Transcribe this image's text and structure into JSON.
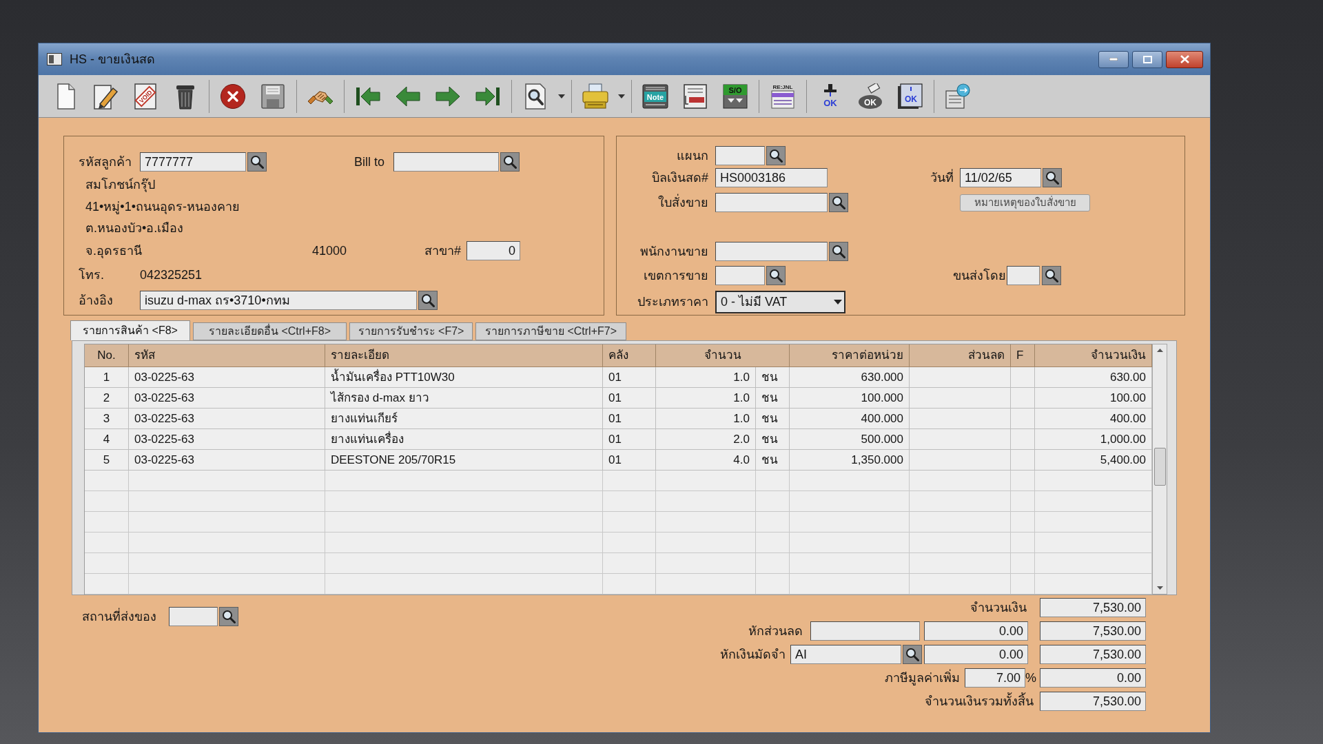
{
  "window": {
    "title": "HS - ขายเงินสด"
  },
  "toolbar": {
    "groups": [
      [
        {
          "kind": "new",
          "dropdown": false
        },
        {
          "kind": "edit",
          "dropdown": false
        },
        {
          "kind": "void",
          "text": "VOID",
          "dropdown": false
        },
        {
          "kind": "delete",
          "dropdown": false
        }
      ],
      [
        {
          "kind": "cancel",
          "dropdown": false
        },
        {
          "kind": "save",
          "dropdown": false
        }
      ],
      [
        {
          "kind": "handshake",
          "dropdown": false
        }
      ],
      [
        {
          "kind": "first",
          "dropdown": false
        },
        {
          "kind": "previous",
          "dropdown": false
        },
        {
          "kind": "next",
          "dropdown": false
        },
        {
          "kind": "last",
          "dropdown": false
        }
      ],
      [
        {
          "kind": "preview",
          "dropdown": true
        }
      ],
      [
        {
          "kind": "print",
          "dropdown": true
        }
      ],
      [
        {
          "kind": "note",
          "text": "Note",
          "dropdown": false
        },
        {
          "kind": "record",
          "dropdown": false
        },
        {
          "kind": "order",
          "text": "S/O",
          "dropdown": false
        }
      ],
      [
        {
          "kind": "journal",
          "text": "RE:JNL",
          "dropdown": false
        }
      ],
      [
        {
          "kind": "stamp",
          "text": "OK",
          "dropdown": false
        },
        {
          "kind": "erase",
          "text": "OK",
          "dropdown": false
        },
        {
          "kind": "approve",
          "text": "OK",
          "dropdown": false
        }
      ],
      [
        {
          "kind": "transfer",
          "dropdown": false
        }
      ]
    ]
  },
  "customer": {
    "code_label": "รหัสลูกค้า",
    "code": "7777777",
    "bill_to_label": "Bill to",
    "name": "สมโภชน์กรุ๊ป",
    "address_lines": [
      "41•หมู่•1•ถนนอุดร-หนองคาย",
      "ต.หนองบัว•อ.เมือง"
    ],
    "province": "จ.อุดรธานี",
    "postcode": "41000",
    "branch_label": "สาขา#",
    "branch": "0",
    "phone_label": "โทร.",
    "phone": "042325251",
    "reference_label": "อ้างอิง",
    "reference": "isuzu d-max ถร•3710•กทม"
  },
  "document": {
    "department_label": "แผนก",
    "cash_bill_label": "บิลเงินสด#",
    "cash_bill": "HS0003186",
    "date_label": "วันที่",
    "date": "11/02/65",
    "sales_order_label": "ใบสั่งขาย",
    "note_button": "หมายเหตุของใบสั่งขาย",
    "salesperson_label": "พนักงานขาย",
    "sales_area_label": "เขตการขาย",
    "shipping_label": "ขนส่งโดย",
    "price_type_label": "ประเภทราคา",
    "price_type": "0 - ไม่มี VAT"
  },
  "tabs": [
    {
      "label": "รายการสินค้า <F8>",
      "selected": true
    },
    {
      "label": "รายละเอียดอื่น <Ctrl+F8>",
      "selected": false
    },
    {
      "label": "รายการรับชำระ <F7>",
      "selected": false
    },
    {
      "label": "รายการภาษีขาย <Ctrl+F7>",
      "selected": false
    }
  ],
  "table": {
    "columns": [
      "No.",
      "รหัส",
      "รายละเอียด",
      "คลัง",
      "จำนวน",
      "ราคาต่อหน่วย",
      "ส่วนลด",
      "F",
      "จำนวนเงิน"
    ],
    "rows": [
      {
        "no": "1",
        "code": "03-0225-63",
        "description": "น้ำมันเครื่อง PTT10W30",
        "warehouse": "01",
        "quantity": "1.0",
        "unit": "ชน",
        "unit_price": "630.000",
        "amount": "630.00"
      },
      {
        "no": "2",
        "code": "03-0225-63",
        "description": "ไส้กรอง d-max ยาว",
        "warehouse": "01",
        "quantity": "1.0",
        "unit": "ชน",
        "unit_price": "100.000",
        "amount": "100.00"
      },
      {
        "no": "3",
        "code": "03-0225-63",
        "description": "ยางแท่นเกียร์",
        "warehouse": "01",
        "quantity": "1.0",
        "unit": "ชน",
        "unit_price": "400.000",
        "amount": "400.00"
      },
      {
        "no": "4",
        "code": "03-0225-63",
        "description": "ยางแท่นเครื่อง",
        "warehouse": "01",
        "quantity": "2.0",
        "unit": "ชน",
        "unit_price": "500.000",
        "amount": "1,000.00"
      },
      {
        "no": "5",
        "code": "03-0225-63",
        "description": "DEESTONE 205/70R15",
        "warehouse": "01",
        "quantity": "4.0",
        "unit": "ชน",
        "unit_price": "1,350.000",
        "amount": "5,400.00"
      }
    ]
  },
  "totals": {
    "delivery_place_label": "สถานที่ส่งของ",
    "amount_label": "จำนวนเงิน",
    "amount": "7,530.00",
    "discount_label": "หักส่วนลด",
    "discount_value": "0.00",
    "after_discount": "7,530.00",
    "deposit_label": "หักเงินมัดจำ",
    "deposit_code": "AI",
    "deposit_value": "0.00",
    "after_deposit": "7,530.00",
    "vat_label": "ภาษีมูลค่าเพิ่ม",
    "vat_rate": "7.00",
    "vat_percent_sign": "%",
    "vat_amount": "0.00",
    "grand_total_label": "จำนวนเงินรวมทั้งสิ้น",
    "grand_total": "7,530.00"
  }
}
